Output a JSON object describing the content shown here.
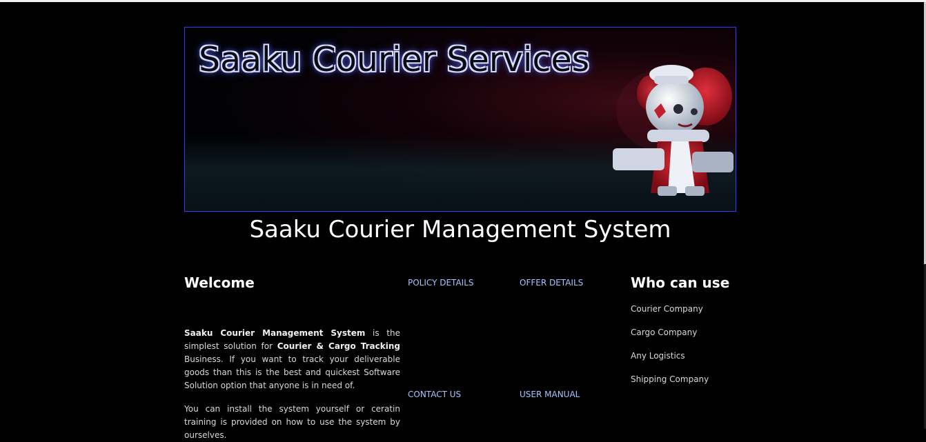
{
  "banner": {
    "title": "Saaku Courier Services",
    "image_alt": "robot-character"
  },
  "page": {
    "heading": "Saaku Courier Management System"
  },
  "welcome": {
    "heading": "Welcome",
    "p1_bold1": "Saaku Courier Management System",
    "p1_text1": " is the simplest solution for ",
    "p1_bold2": "Courier & Cargo Tracking",
    "p1_text2": " Business. If you want to track your deliverable goods than this is the best and quickest Software Solution option that anyone is in need of.",
    "p2": "You can install the system yourself or ceratin training is provided on how to use the system by ourselves."
  },
  "links": {
    "policy": "POLICY DETAILS",
    "offer": "OFFER DETAILS",
    "contact": "CONTACT US",
    "manual": "USER MANUAL"
  },
  "who": {
    "heading": "Who can use",
    "items": [
      "Courier Company",
      "Cargo Company",
      "Any Logistics",
      "Shipping Company"
    ]
  },
  "colors": {
    "background": "#000000",
    "link": "#a6c6ff",
    "banner_border": "#3a3aff"
  }
}
